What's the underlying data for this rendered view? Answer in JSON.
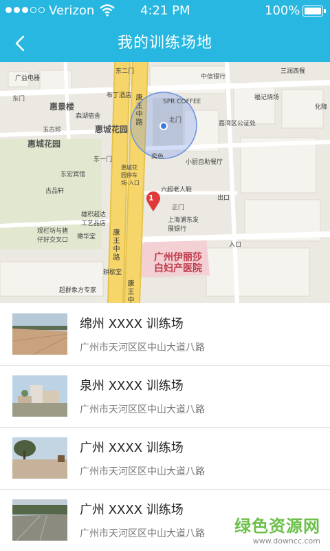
{
  "status_bar": {
    "carrier": "Verizon",
    "time": "4:21 PM",
    "battery": "100%"
  },
  "header": {
    "title": "我的训练场地"
  },
  "map": {
    "labels": [
      "广益电器",
      "东门",
      "东二门",
      "布丁酒店",
      "中信银行",
      "三润西餐",
      "惠景楼",
      "森湖宿舍",
      "SPR COFFEE",
      "北门",
      "福记烧场",
      "玉古珍",
      "惠城花园",
      "惠城花园",
      "荔湾区公证处",
      "化降",
      "东一门",
      "东宏宾馆",
      "惠城花园停车场-入口",
      "奕色",
      "小厨自助餐厅",
      "古品轩",
      "六超老人鞋",
      "雄积超达工艺品店",
      "正门",
      "出口",
      "观栏坊与猪仔好交叉口",
      "德华堂",
      "上海浦东发展银行",
      "入口",
      "耕歇堂",
      "超群象方专家",
      "康王中路",
      "康王中路",
      "康王中路",
      "广州伊丽莎白妇产医院"
    ]
  },
  "venues": [
    {
      "name": "绵州 XXXX 训练场",
      "address": "广州市天河区区中山大道八路"
    },
    {
      "name": "泉州 XXXX 训练场",
      "address": "广州市天河区区中山大道八路"
    },
    {
      "name": "广州 XXXX 训练场",
      "address": "广州市天河区区中山大道八路"
    },
    {
      "name": "广州 XXXX 训练场",
      "address": "广州市天河区区中山大道八路"
    }
  ],
  "pin": {
    "number": "1"
  },
  "watermark": {
    "name": "绿色资源网",
    "url": "www.downcc.com"
  },
  "colors": {
    "header": "#27b7e0",
    "road_main": "#f6d56a",
    "hospital": "#c0394a",
    "watermark": "#6cc04a"
  }
}
